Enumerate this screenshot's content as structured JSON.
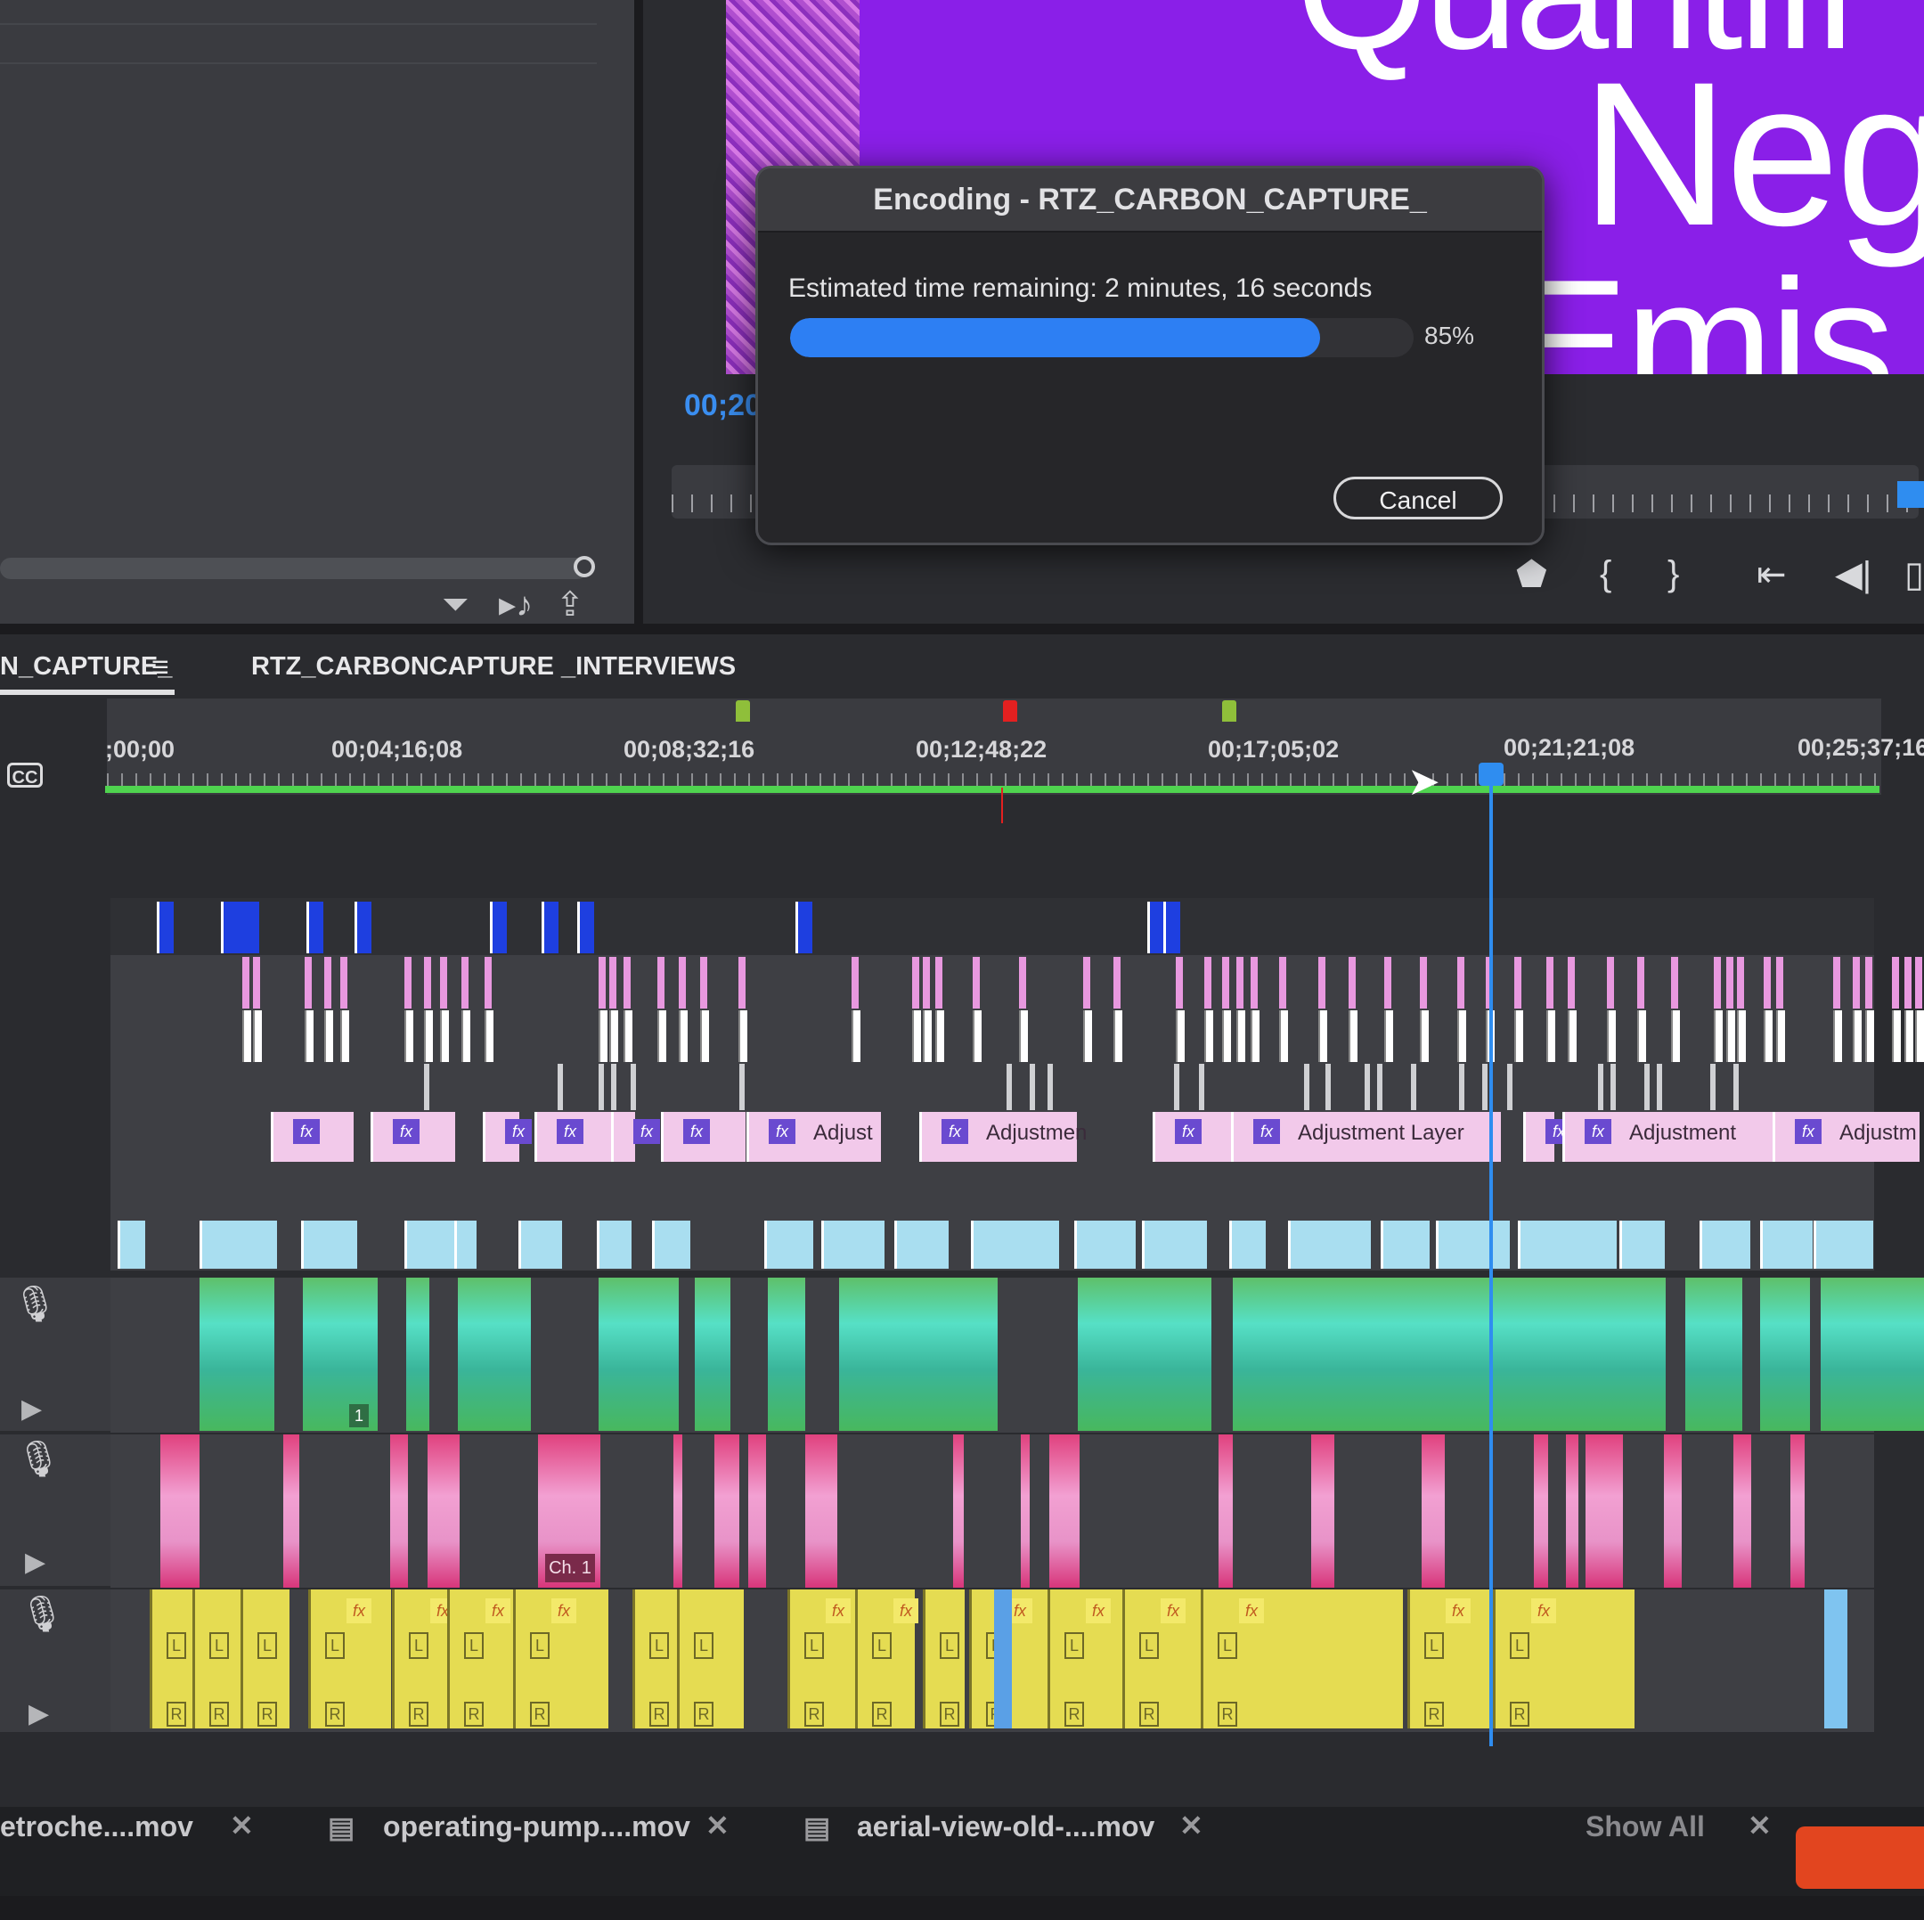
{
  "dialog": {
    "title": "Encoding - RTZ_CARBON_CAPTURE_",
    "time_remaining": "Estimated time remaining: 2 minutes, 16 seconds",
    "progress_percent_label": "85%",
    "progress_fraction": 0.85,
    "cancel_label": "Cancel"
  },
  "monitor": {
    "title_lines": [
      "Quantifi",
      "Neg",
      "Emis"
    ],
    "timecode_partial": "00;20"
  },
  "timeline": {
    "tabs": [
      "N_CAPTURE_",
      "RTZ_CARBONCAPTURE _INTERVIEWS"
    ],
    "menu_icon": "hamburger-icon",
    "timecodes": [
      ";00;00",
      "00;04;16;08",
      "00;08;32;16",
      "00;12;48;22",
      "00;17;05;02",
      "00;21;21;08",
      "00;25;37;16"
    ],
    "cc_label": "CC",
    "adjustment_labels": [
      "Adjust",
      "Adjustmen",
      "Adjustment Layer",
      "Adjustment",
      "Adjustm"
    ],
    "fx_label": "fx",
    "channel_label": "Ch. 1",
    "clip_number": "1",
    "left_tag": "L",
    "right_tag": "R",
    "colors": {
      "playhead": "#2f8df0",
      "work_area": "#4fd34f",
      "marker_green": "#8fbf3a",
      "marker_red": "#e32020"
    }
  },
  "bottom_tabs": [
    "etroche....mov",
    "operating-pump....mov",
    "aerial-view-old-....mov",
    "Show All"
  ]
}
